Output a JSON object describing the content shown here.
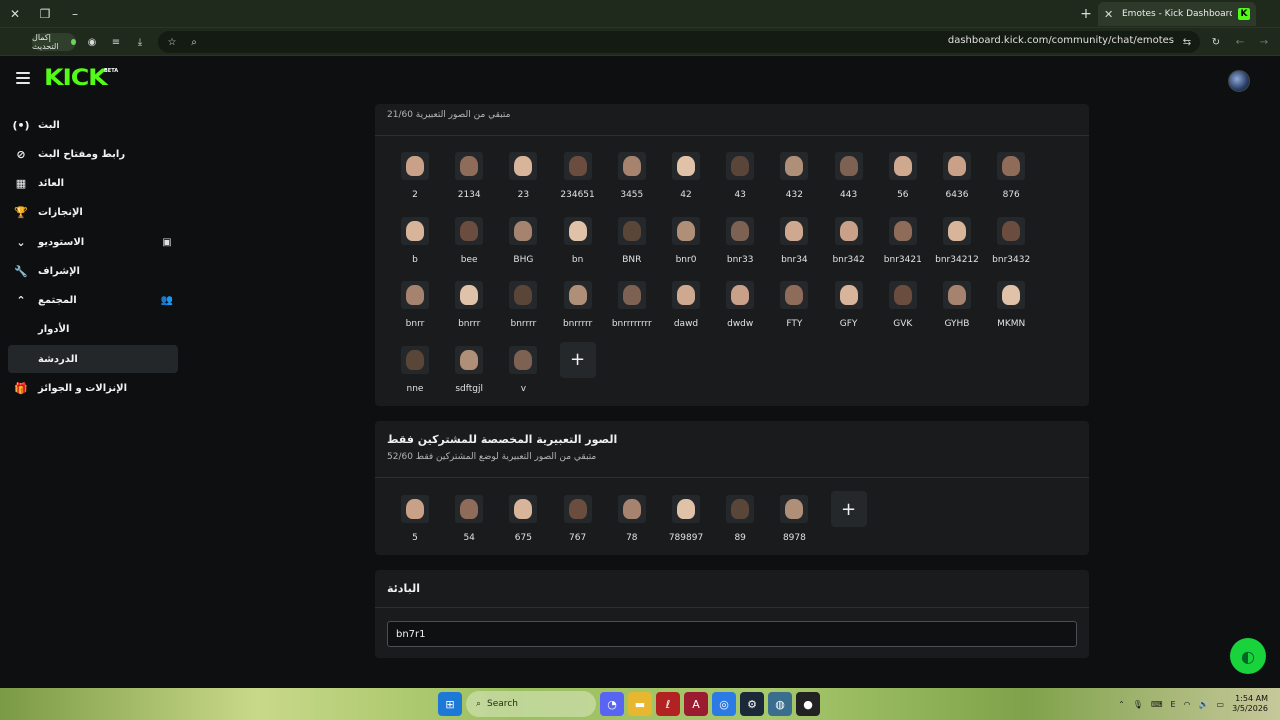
{
  "browser": {
    "tab_title": "Emotes - Kick Dashboard",
    "tab_favicon": "K",
    "update_button": "إكمال التحديث",
    "url": "dashboard.kick.com/community/chat/emotes"
  },
  "header": {
    "logo": "KICK",
    "logo_badge": "BETA"
  },
  "sidebar": {
    "items": [
      {
        "label": "البث",
        "icon": "broadcast-icon"
      },
      {
        "label": "رابط ومفتاح البث",
        "icon": "link-icon"
      },
      {
        "label": "العائد",
        "icon": "revenue-icon"
      },
      {
        "label": "الإنجازات",
        "icon": "trophy-icon"
      },
      {
        "label": "الاستوديو",
        "icon": "chevron-down-icon"
      },
      {
        "label": "الإشراف",
        "icon": "wrench-icon"
      },
      {
        "label": "المجتمع",
        "icon": "chevron-up-icon"
      },
      {
        "label": "الأدوار",
        "icon": ""
      },
      {
        "label": "الدردشة",
        "icon": ""
      },
      {
        "label": "الإنزالات و الجوائز",
        "icon": "gift-icon"
      }
    ]
  },
  "channel_emotes": {
    "subtitle": "متبقي من الصور التعبيرية 21/60",
    "emotes": [
      "2",
      "2134",
      "23",
      "234651",
      "3455",
      "42",
      "43",
      "432",
      "443",
      "56",
      "6436",
      "876",
      "b",
      "bee",
      "BHG",
      "bn",
      "BNR",
      "bnr0",
      "bnr33",
      "bnr34",
      "bnr342",
      "bnr3421",
      "bnr34212",
      "bnr3432",
      "bnrr",
      "bnrrr",
      "bnrrrr",
      "bnrrrrr",
      "bnrrrrrrrr",
      "dawd",
      "dwdw",
      "FTY",
      "GFY",
      "GVK",
      "GYHB",
      "MKMN",
      "nne",
      "sdftgjl",
      "v"
    ],
    "add_label": "+"
  },
  "subscriber_emotes": {
    "title": "الصور التعبيرية المخصصة للمشتركين فقط",
    "subtitle": "متبقي من الصور التعبيرية لوضع المشتركين فقط 52/60",
    "emotes": [
      "5",
      "54",
      "675",
      "767",
      "78",
      "789897",
      "89",
      "8978"
    ],
    "add_label": "+"
  },
  "prefix": {
    "title": "البادئة",
    "value": "bn7r1"
  },
  "taskbar": {
    "search_placeholder": "Search",
    "time": "1:54 AM",
    "date": "3/5/2026",
    "lang": "E"
  },
  "colors": {
    "brand": "#53fc18",
    "panel": "#191b1d",
    "background": "#0e0f10"
  }
}
